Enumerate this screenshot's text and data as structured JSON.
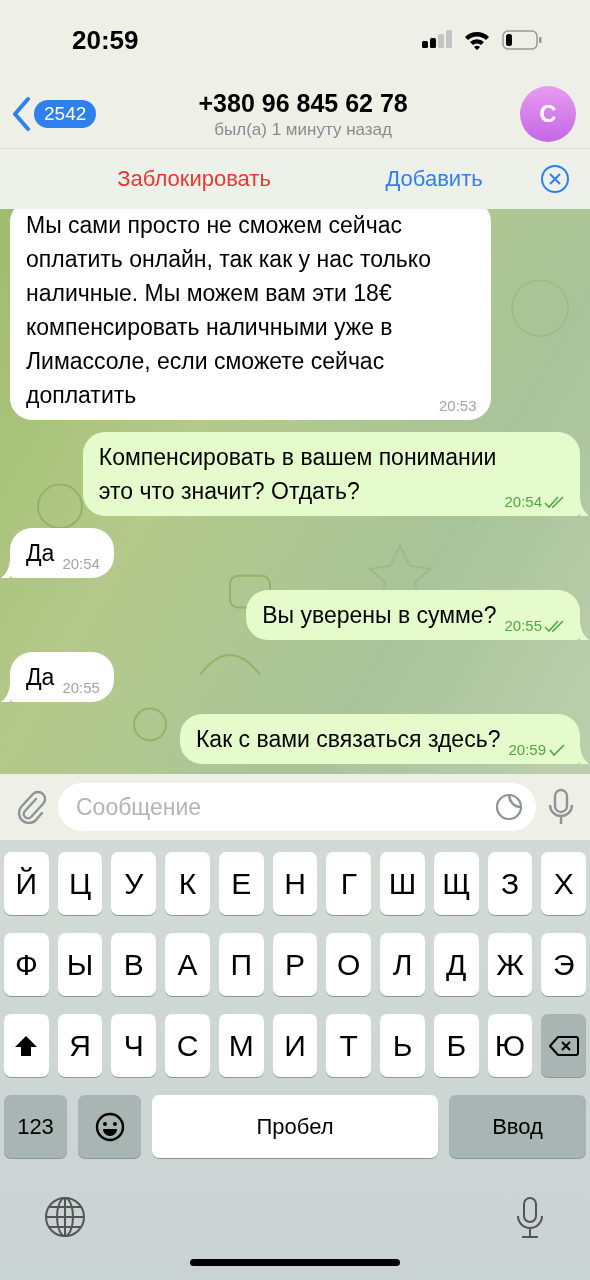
{
  "status_bar": {
    "time": "20:59"
  },
  "header": {
    "back_count": "2542",
    "title": "+380 96 845 62 78",
    "subtitle": "был(а) 1 минуту назад",
    "avatar_letter": "С"
  },
  "action_bar": {
    "block": "Заблокировать",
    "add": "Добавить"
  },
  "messages": [
    {
      "kind": "in",
      "text": "Мы сами просто не сможем сейчас\nоплатить онлайн, так как у нас только\nналичные. Мы можем вам эти 18€\nкомпенсировать наличными уже в\nЛимассоле, если сможете сейчас\nдоплатить",
      "time": "20:53",
      "tail": false
    },
    {
      "kind": "out",
      "text": "Компенсировать в вашем понимании\nэто что значит? Отдать?",
      "time": "20:54",
      "read": true,
      "tail": true
    },
    {
      "kind": "in",
      "text": "Да",
      "time": "20:54",
      "tail": true
    },
    {
      "kind": "out",
      "text": "Вы уверены в сумме?",
      "time": "20:55",
      "read": true,
      "tail": true
    },
    {
      "kind": "in",
      "text": "Да",
      "time": "20:55",
      "tail": true
    },
    {
      "kind": "out",
      "text": "Как с вами связаться здесь?",
      "time": "20:59",
      "read": false,
      "tail": true
    }
  ],
  "composer": {
    "placeholder": "Сообщение"
  },
  "keyboard": {
    "rows": [
      [
        "Й",
        "Ц",
        "У",
        "К",
        "Е",
        "Н",
        "Г",
        "Ш",
        "Щ",
        "З",
        "Х"
      ],
      [
        "Ф",
        "Ы",
        "В",
        "А",
        "П",
        "Р",
        "О",
        "Л",
        "Д",
        "Ж",
        "Э"
      ],
      [
        {
          "kind": "shift"
        },
        "Я",
        "Ч",
        "С",
        "М",
        "И",
        "Т",
        "Ь",
        "Б",
        "Ю",
        {
          "kind": "delete"
        }
      ]
    ],
    "numbers_key": "123",
    "space_key": "Пробел",
    "return_key": "Ввод"
  }
}
